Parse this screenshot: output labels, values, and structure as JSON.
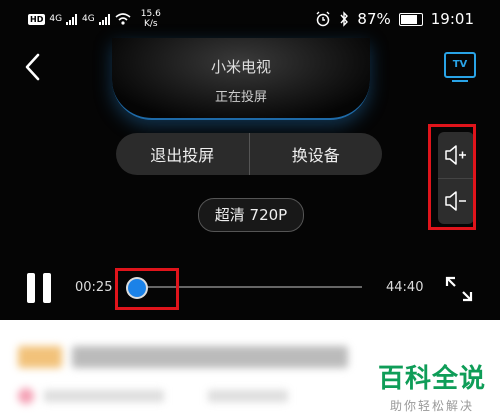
{
  "status_bar": {
    "left_badge": "HD",
    "signal1": "4G",
    "signal2": "4G",
    "speed_value": "15.6",
    "speed_unit": "K/s",
    "battery": "87%",
    "time": "19:01"
  },
  "device": {
    "name": "小米电视",
    "state": "正在投屏",
    "tv_badge": "TV"
  },
  "buttons": {
    "exit_cast": "退出投屏",
    "switch_device": "换设备"
  },
  "quality": "超清 720P",
  "playback": {
    "elapsed": "00:25",
    "duration": "44:40",
    "progress": 0.009
  },
  "watermark": {
    "title": "百科全说",
    "subtitle": "助你轻松解决"
  },
  "colors": {
    "accent": "#1b82e8",
    "highlight": "#e0141b",
    "watermark": "#0f9d58"
  }
}
